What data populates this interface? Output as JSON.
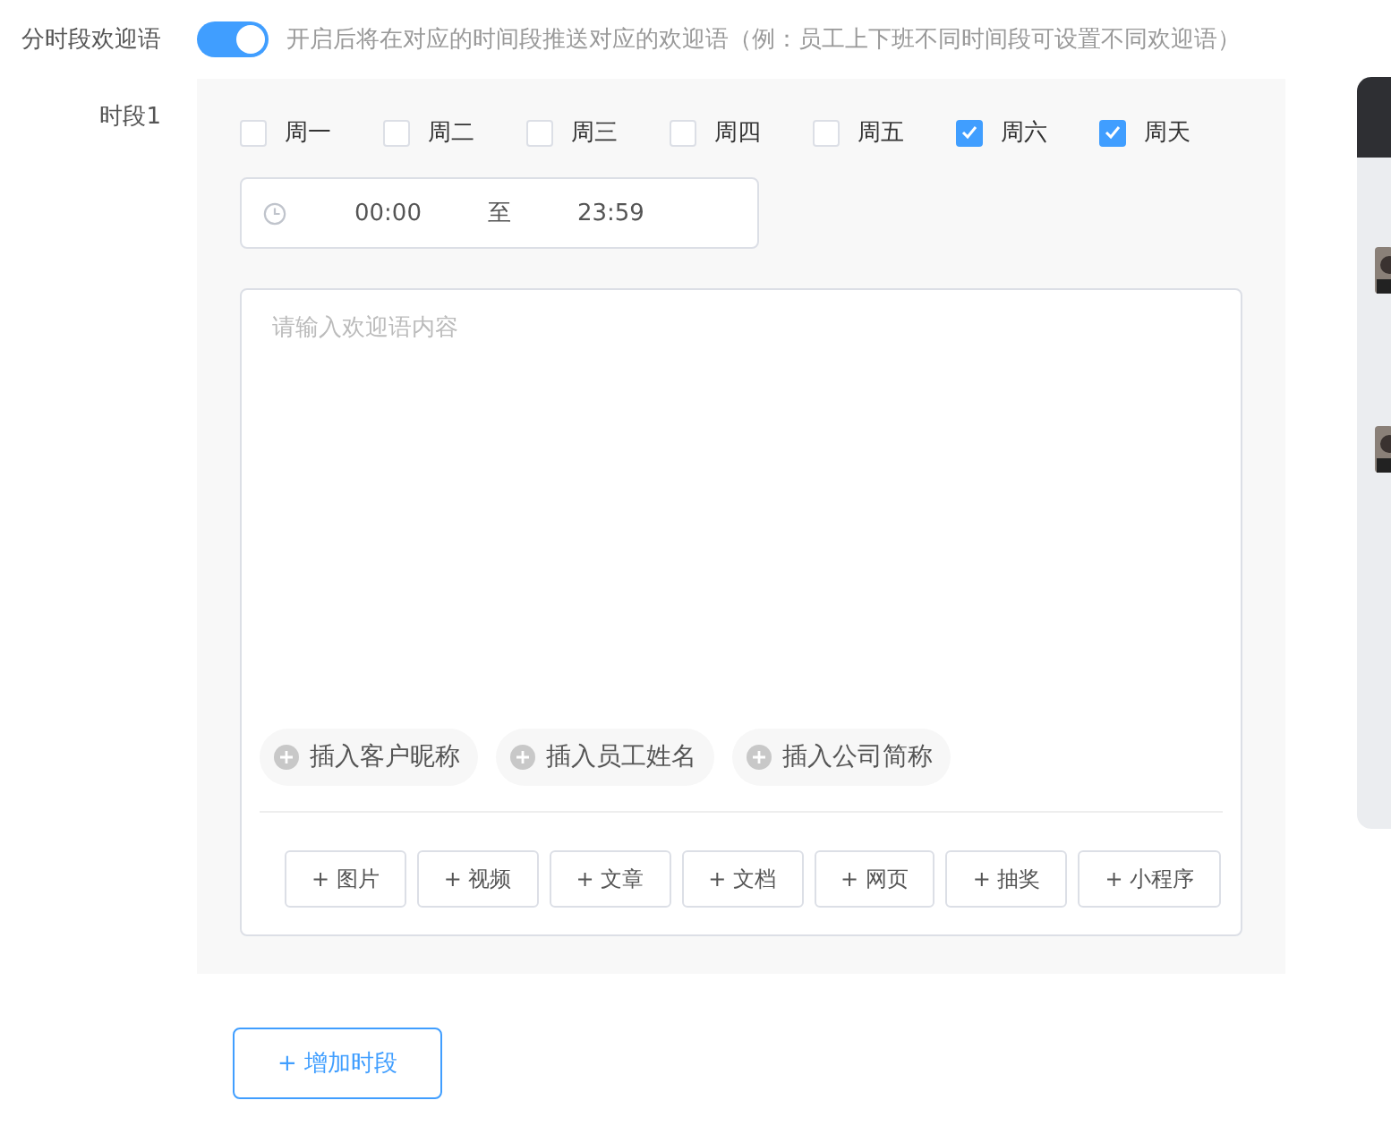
{
  "setting": {
    "label": "分时段欢迎语",
    "on": true,
    "hint": "开启后将在对应的时间段推送对应的欢迎语（例：员工上下班不同时间段可设置不同欢迎语）"
  },
  "periods": [
    {
      "label": "时段1",
      "days": [
        {
          "label": "周一",
          "checked": false
        },
        {
          "label": "周二",
          "checked": false
        },
        {
          "label": "周三",
          "checked": false
        },
        {
          "label": "周四",
          "checked": false
        },
        {
          "label": "周五",
          "checked": false
        },
        {
          "label": "周六",
          "checked": true
        },
        {
          "label": "周天",
          "checked": true
        }
      ],
      "time": {
        "start": "00:00",
        "separator": "至",
        "end": "23:59"
      },
      "message": {
        "placeholder": "请输入欢迎语内容"
      },
      "inserts": [
        "插入客户昵称",
        "插入员工姓名",
        "插入公司简称"
      ],
      "attachments": [
        "+ 图片",
        "+ 视频",
        "+ 文章",
        "+ 文档",
        "+ 网页",
        "+ 抽奖",
        "+ 小程序"
      ]
    }
  ],
  "add_button": "+ 增加时段"
}
